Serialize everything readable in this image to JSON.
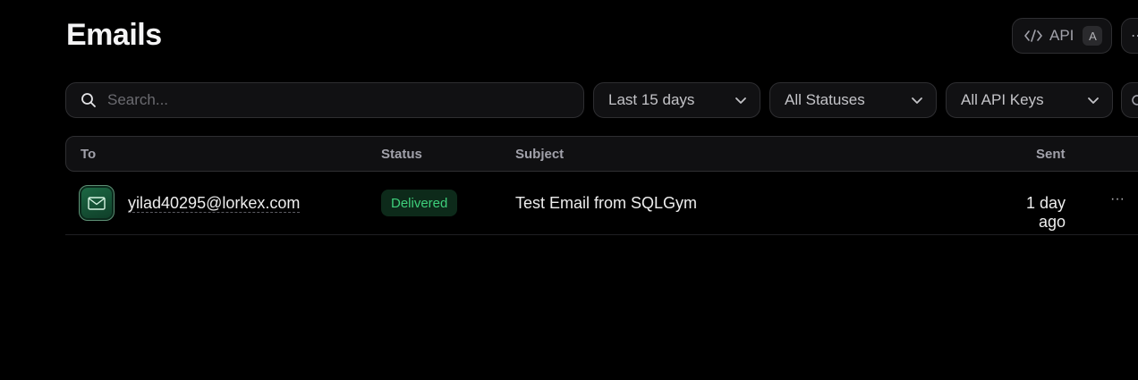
{
  "page": {
    "title": "Emails"
  },
  "header": {
    "api_label": "API",
    "api_shortcut": "A",
    "more_label": "⋯"
  },
  "filters": {
    "search_placeholder": "Search...",
    "search_value": "",
    "date_range": "Last 15 days",
    "status": "All Statuses",
    "api_keys": "All API Keys"
  },
  "table": {
    "columns": {
      "to": "To",
      "status": "Status",
      "subject": "Subject",
      "sent": "Sent"
    },
    "rows": [
      {
        "to": "yilad40295@lorkex.com",
        "status": "Delivered",
        "subject": "Test Email from SQLGym",
        "sent": "1 day ago",
        "more": "···"
      }
    ]
  },
  "colors": {
    "background": "#000000",
    "surface": "#111113",
    "border": "#2e2e31",
    "delivered_text": "#3ecf7b",
    "delivered_bg": "#0d2a1a",
    "avatar_green": "#1d6a45"
  },
  "icons": {
    "api": "code-icon",
    "search": "search-icon",
    "chevron": "chevron-down-icon",
    "refresh": "refresh-icon",
    "avatar": "mail-icon",
    "row_more": "ellipsis-icon"
  }
}
